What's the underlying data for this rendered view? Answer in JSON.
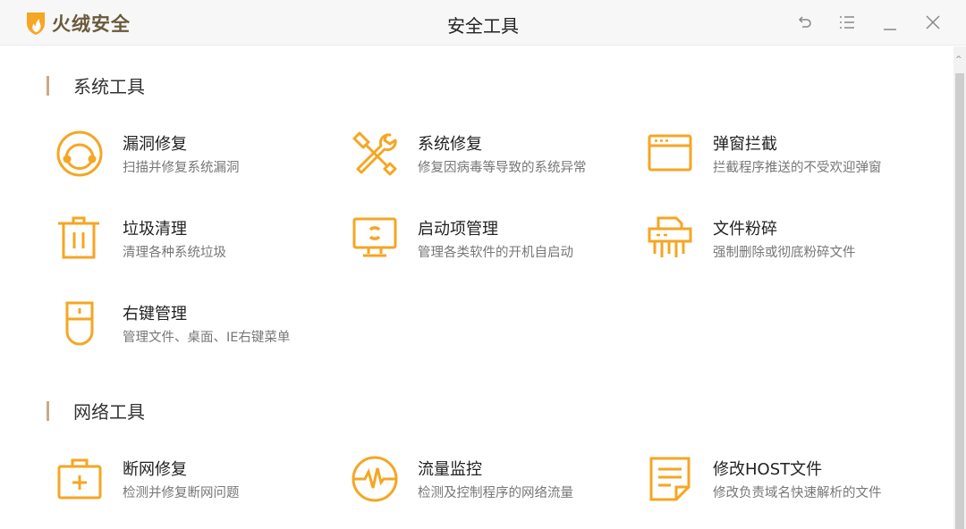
{
  "app": {
    "name": "火绒安全",
    "title": "安全工具"
  },
  "window_controls": {
    "back": "back-icon",
    "menu": "menu-icon",
    "minimize": "minimize-icon",
    "close": "close-icon"
  },
  "accent": "#f5a623",
  "sections": [
    {
      "label": "系统工具",
      "items": [
        {
          "title": "漏洞修复",
          "desc": "扫描并修复系统漏洞",
          "icon": "vulnerability-icon"
        },
        {
          "title": "系统修复",
          "desc": "修复因病毒等导致的系统异常",
          "icon": "tools-icon"
        },
        {
          "title": "弹窗拦截",
          "desc": "拦截程序推送的不受欢迎弹窗",
          "icon": "popup-window-icon"
        },
        {
          "title": "垃圾清理",
          "desc": "清理各种系统垃圾",
          "icon": "trash-icon"
        },
        {
          "title": "启动项管理",
          "desc": "管理各类软件的开机自启动",
          "icon": "monitor-icon"
        },
        {
          "title": "文件粉碎",
          "desc": "强制删除或彻底粉碎文件",
          "icon": "shredder-icon"
        },
        {
          "title": "右键管理",
          "desc": "管理文件、桌面、IE右键菜单",
          "icon": "mouse-icon"
        }
      ]
    },
    {
      "label": "网络工具",
      "items": [
        {
          "title": "断网修复",
          "desc": "检测并修复断网问题",
          "icon": "first-aid-kit-icon"
        },
        {
          "title": "流量监控",
          "desc": "检测及控制程序的网络流量",
          "icon": "traffic-monitor-icon"
        },
        {
          "title": "修改HOST文件",
          "desc": "修改负责域名快速解析的文件",
          "icon": "host-file-icon"
        }
      ]
    }
  ]
}
